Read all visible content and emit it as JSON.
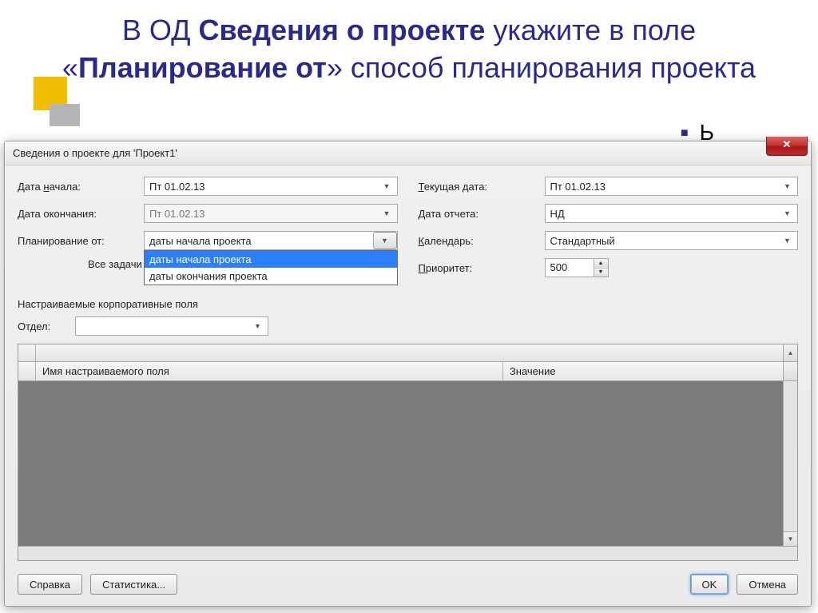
{
  "slide": {
    "t1": "В ОД ",
    "t2": "Сведения о проекте",
    "t3": " укажите в поле «",
    "t4": "Планирование от",
    "t5": "» способ планирования проекта",
    "bullet": "Ь"
  },
  "dialog": {
    "title": "Сведения о проекте для 'Проект1'",
    "close_glyph": "✕",
    "left": {
      "start_label_pre": "Дата ",
      "start_label_u": "н",
      "start_label_post": "ачала:",
      "start_value": "Пт 01.02.13",
      "end_label": "Дата окончания:",
      "end_value": "Пт 01.02.13",
      "plan_label": "Планирование от:",
      "plan_value": "даты начала проекта",
      "plan_options": [
        "даты начала проекта",
        "даты окончания проекта"
      ],
      "note_pre": "Все задачи"
    },
    "right": {
      "cur_label_u": "Т",
      "cur_label_post": "екущая дата:",
      "cur_value": "Пт 01.02.13",
      "rep_label": "Дата отчета:",
      "rep_value": "НД",
      "cal_label_u": "К",
      "cal_label_post": "алендарь:",
      "cal_value": "Стандартный",
      "pri_label_u": "П",
      "pri_label_post": "риоритет:",
      "pri_value": "500"
    },
    "section": "Настраиваемые корпоративные поля",
    "dept_label": "Отдел:",
    "grid": {
      "col1": "Имя настраиваемого поля",
      "col2": "Значение"
    },
    "buttons": {
      "help": "Справка",
      "stats": "Статистика...",
      "ok": "OK",
      "cancel": "Отмена"
    }
  }
}
